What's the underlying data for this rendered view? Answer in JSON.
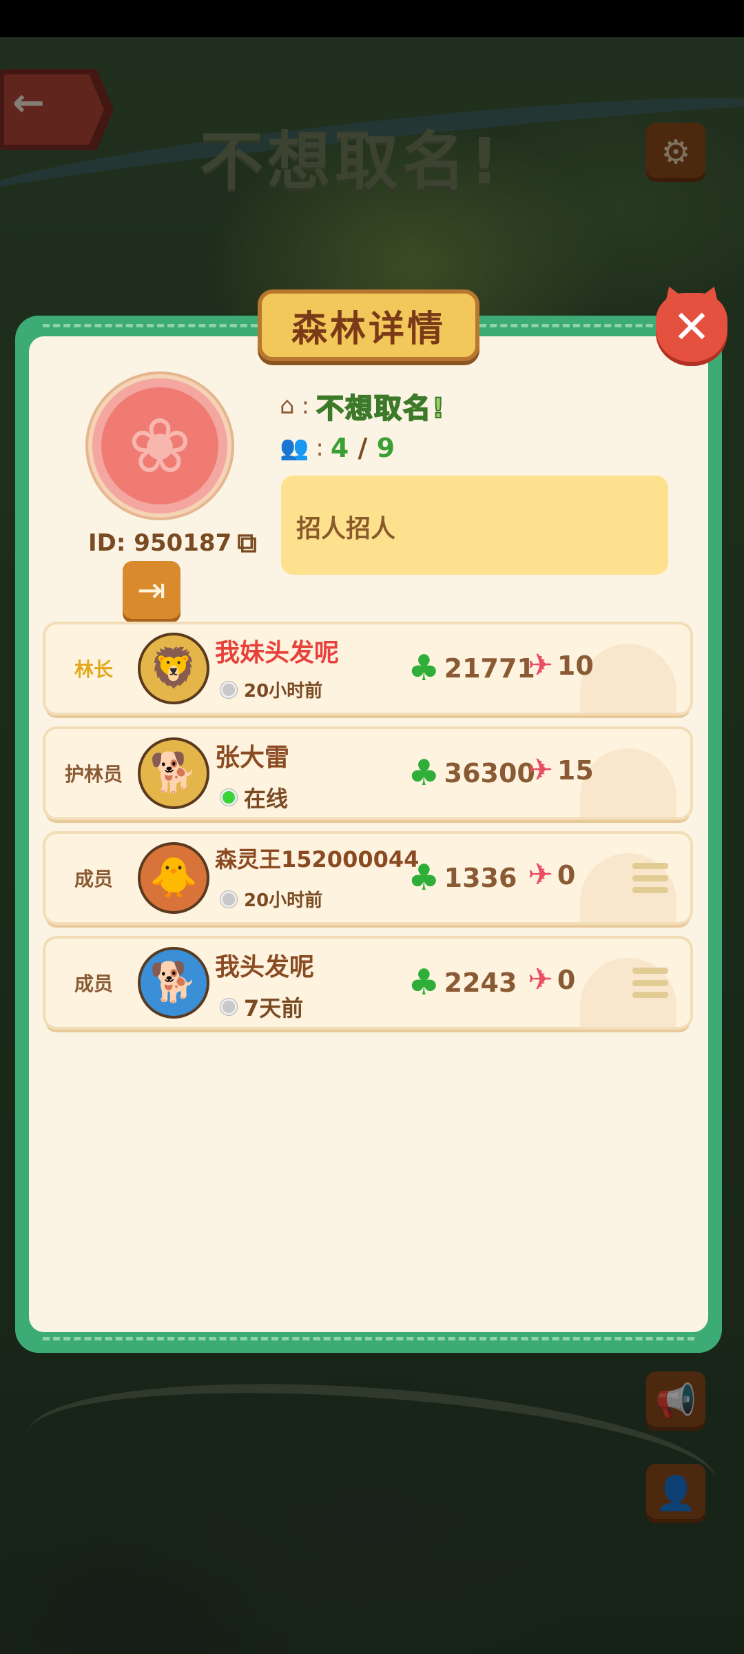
{
  "background": {
    "world_title": "不想取名!",
    "back_icon": "←",
    "settings_icon": "⚙",
    "announce_icon": "📢",
    "profile_icon": "👤"
  },
  "panel": {
    "title": "森林详情",
    "close_icon": "✕"
  },
  "forest": {
    "emblem_icon": "❀",
    "id_text": "ID: 950187",
    "copy_icon": "⧉",
    "leave_icon": "⇥",
    "home_icon": "⌂",
    "name": "不想取名!",
    "members_icon": "👥",
    "member_current": "4",
    "member_sep": "/",
    "member_max": "9",
    "colon": ":",
    "description": "招人招人"
  },
  "members": [
    {
      "role": "林长",
      "avatar": "🦁",
      "name": "我妹头发呢",
      "status": "20小时前",
      "online": false,
      "clovers": "21771",
      "gifts": "10"
    },
    {
      "role": "护林员",
      "avatar": "🐕",
      "name": "张大雷",
      "status": "在线",
      "online": true,
      "clovers": "36300",
      "gifts": "15"
    },
    {
      "role": "成员",
      "avatar": "🐥",
      "name": "森灵王152000044",
      "status": "20小时前",
      "online": false,
      "clovers": "1336",
      "gifts": "0"
    },
    {
      "role": "成员",
      "avatar": "🐕",
      "name": "我头发呢",
      "status": "7天前",
      "online": false,
      "clovers": "2243",
      "gifts": "0"
    }
  ],
  "icons": {
    "clover": "♣",
    "heart_plane": "✈"
  },
  "colors": {
    "panel_green": "#3dab76",
    "panel_cream": "#fbf4e4",
    "leader_gold": "#e3a91e",
    "highlight_red": "#e8413c",
    "online_green": "#39d33a"
  }
}
